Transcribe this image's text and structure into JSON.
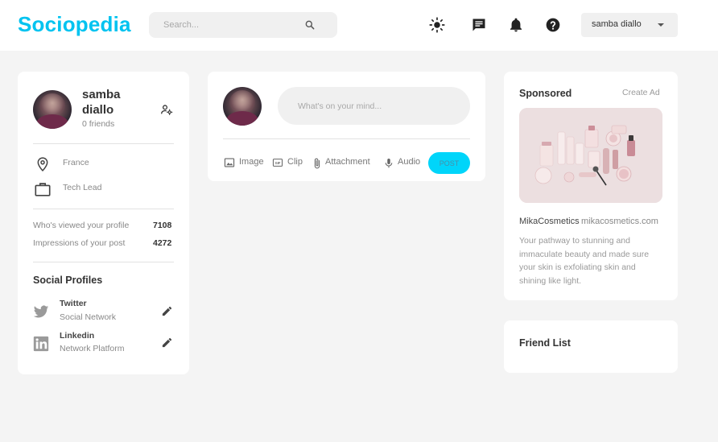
{
  "header": {
    "logo": "Sociopedia",
    "search_placeholder": "Search...",
    "user_select_value": "samba diallo"
  },
  "profile": {
    "name": "samba diallo",
    "friends": "0 friends",
    "location": "France",
    "occupation": "Tech Lead",
    "stats": [
      {
        "label": "Who's viewed your profile",
        "value": "7108"
      },
      {
        "label": "Impressions of your post",
        "value": "4272"
      }
    ],
    "social_heading": "Social Profiles",
    "socials": [
      {
        "name": "Twitter",
        "desc": "Social Network"
      },
      {
        "name": "Linkedin",
        "desc": "Network Platform"
      }
    ]
  },
  "post": {
    "placeholder": "What's on your mind...",
    "actions": [
      "Image",
      "Clip",
      "Attachment",
      "Audio"
    ],
    "post_button": "POST"
  },
  "ad": {
    "heading": "Sponsored",
    "create": "Create Ad",
    "brand": "MikaCosmetics",
    "site": "mikacosmetics.com",
    "desc": "Your pathway to stunning and immaculate beauty and made sure your skin is exfoliating skin and shining like light."
  },
  "friends": {
    "heading": "Friend List"
  },
  "colors": {
    "brand": "#00c3f0",
    "post_button": "#00d5fa",
    "background": "#f4f4f4"
  },
  "icons": [
    "search-icon",
    "light-mode-icon",
    "message-icon",
    "notification-icon",
    "help-icon",
    "manage-account-icon",
    "location-icon",
    "work-icon",
    "twitter-icon",
    "linkedin-icon",
    "edit-icon",
    "image-icon",
    "gif-icon",
    "attachment-icon",
    "mic-icon"
  ]
}
